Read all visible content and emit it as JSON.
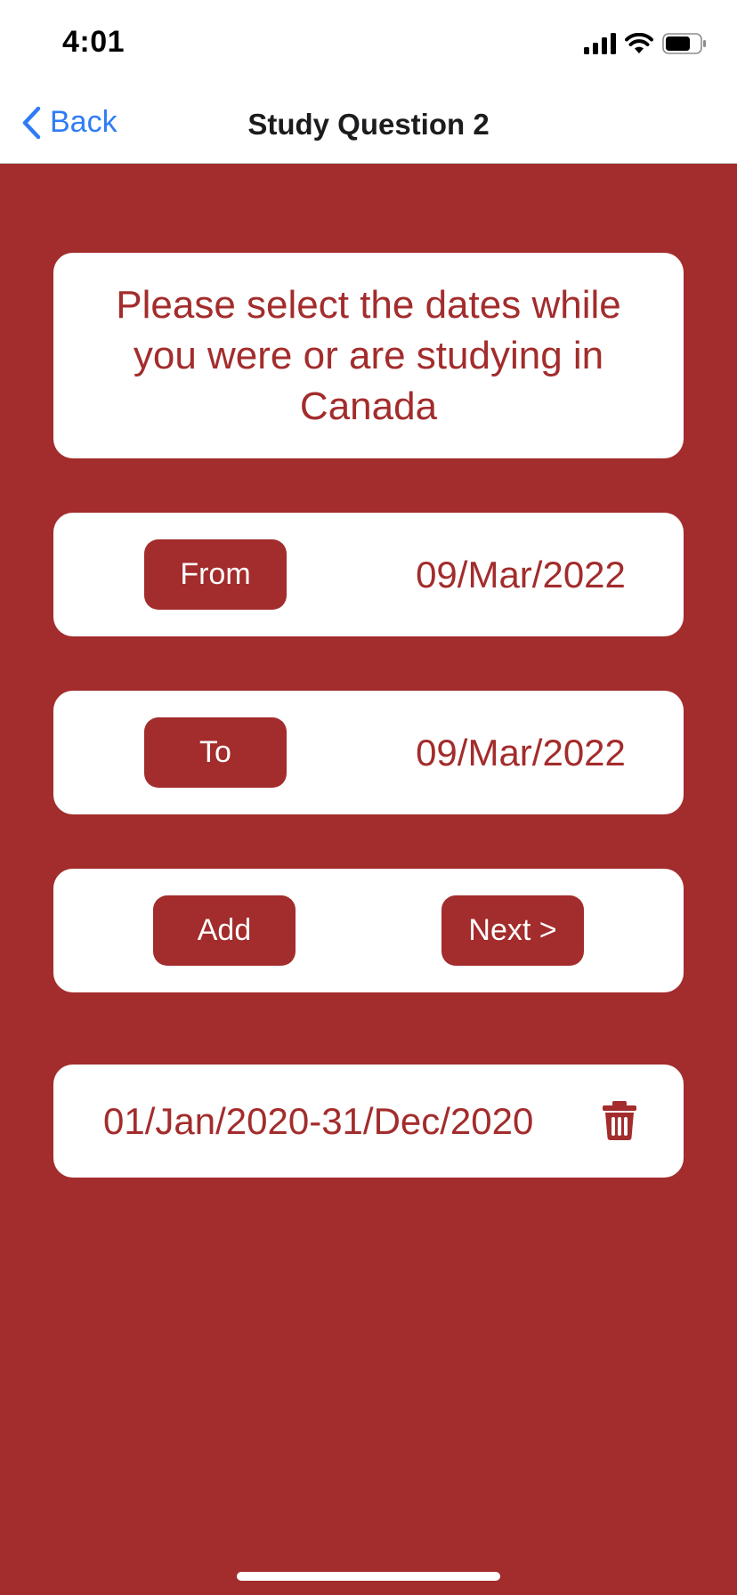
{
  "status_bar": {
    "time": "4:01",
    "icons": [
      "cellular-signal-icon",
      "wifi-icon",
      "battery-icon"
    ],
    "battery_level": 0.7
  },
  "nav": {
    "back_label": "Back",
    "back_icon": "chevron-left-icon",
    "title": "Study Question 2"
  },
  "question": {
    "text": "Please select the dates while you were or are studying in Canada"
  },
  "from_row": {
    "button_label": "From",
    "value": "09/Mar/2022"
  },
  "to_row": {
    "button_label": "To",
    "value": "09/Mar/2022"
  },
  "actions": {
    "add_label": "Add",
    "next_label": "Next >"
  },
  "entries": [
    {
      "range": "01/Jan/2020-31/Dec/2020",
      "delete_icon": "trash-icon"
    }
  ],
  "colors": {
    "primary": "#a32c2c",
    "card": "#ffffff",
    "link": "#2f7cf6"
  }
}
